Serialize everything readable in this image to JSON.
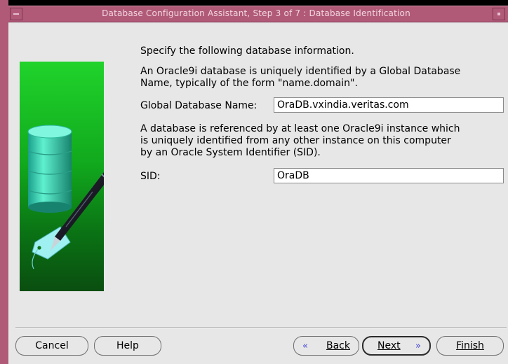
{
  "window": {
    "title": "Database Configuration Assistant, Step 3 of 7 : Database Identification"
  },
  "form": {
    "intro": "Specify the following database information.",
    "description_line1": "An Oracle9i database is uniquely identified by a Global Database",
    "description_line2": "Name, typically of the form \"name.domain\".",
    "global_name_label": "Global Database Name:",
    "global_name_value": "OraDB.vxindia.veritas.com",
    "sid_description_line1": "A database is referenced by at least one Oracle9i instance which",
    "sid_description_line2": "is uniquely identified from any other instance on this computer",
    "sid_description_line3": "by an Oracle System Identifier (SID).",
    "sid_label": "SID:",
    "sid_value": "OraDB"
  },
  "buttons": {
    "cancel": "Cancel",
    "help": "Help",
    "back": "Back",
    "next": "Next",
    "finish": "Finish",
    "back_icon": "«",
    "next_icon": "»"
  },
  "colors": {
    "titlebar": "#b05a78",
    "art_green": "#1ccf28",
    "background": "#e7e7e7"
  },
  "icons": {
    "art": "database-cylinder-with-pen-and-tag"
  }
}
